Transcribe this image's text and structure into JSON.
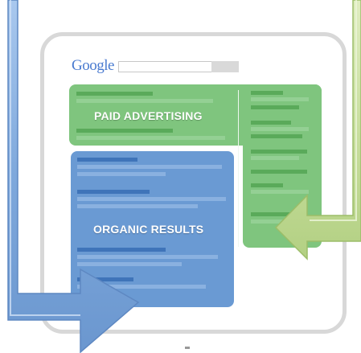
{
  "logo_text": "Google",
  "paid_label": "PAID ADVERTISING",
  "organic_label": "ORGANIC RESULTS",
  "colors": {
    "paid_region": "#7fc57e",
    "organic_region": "#6a9ad3",
    "blue_arrow": "#8fb5e3",
    "green_arrow": "#cfe3a7",
    "frame": "#d8d8d8"
  }
}
